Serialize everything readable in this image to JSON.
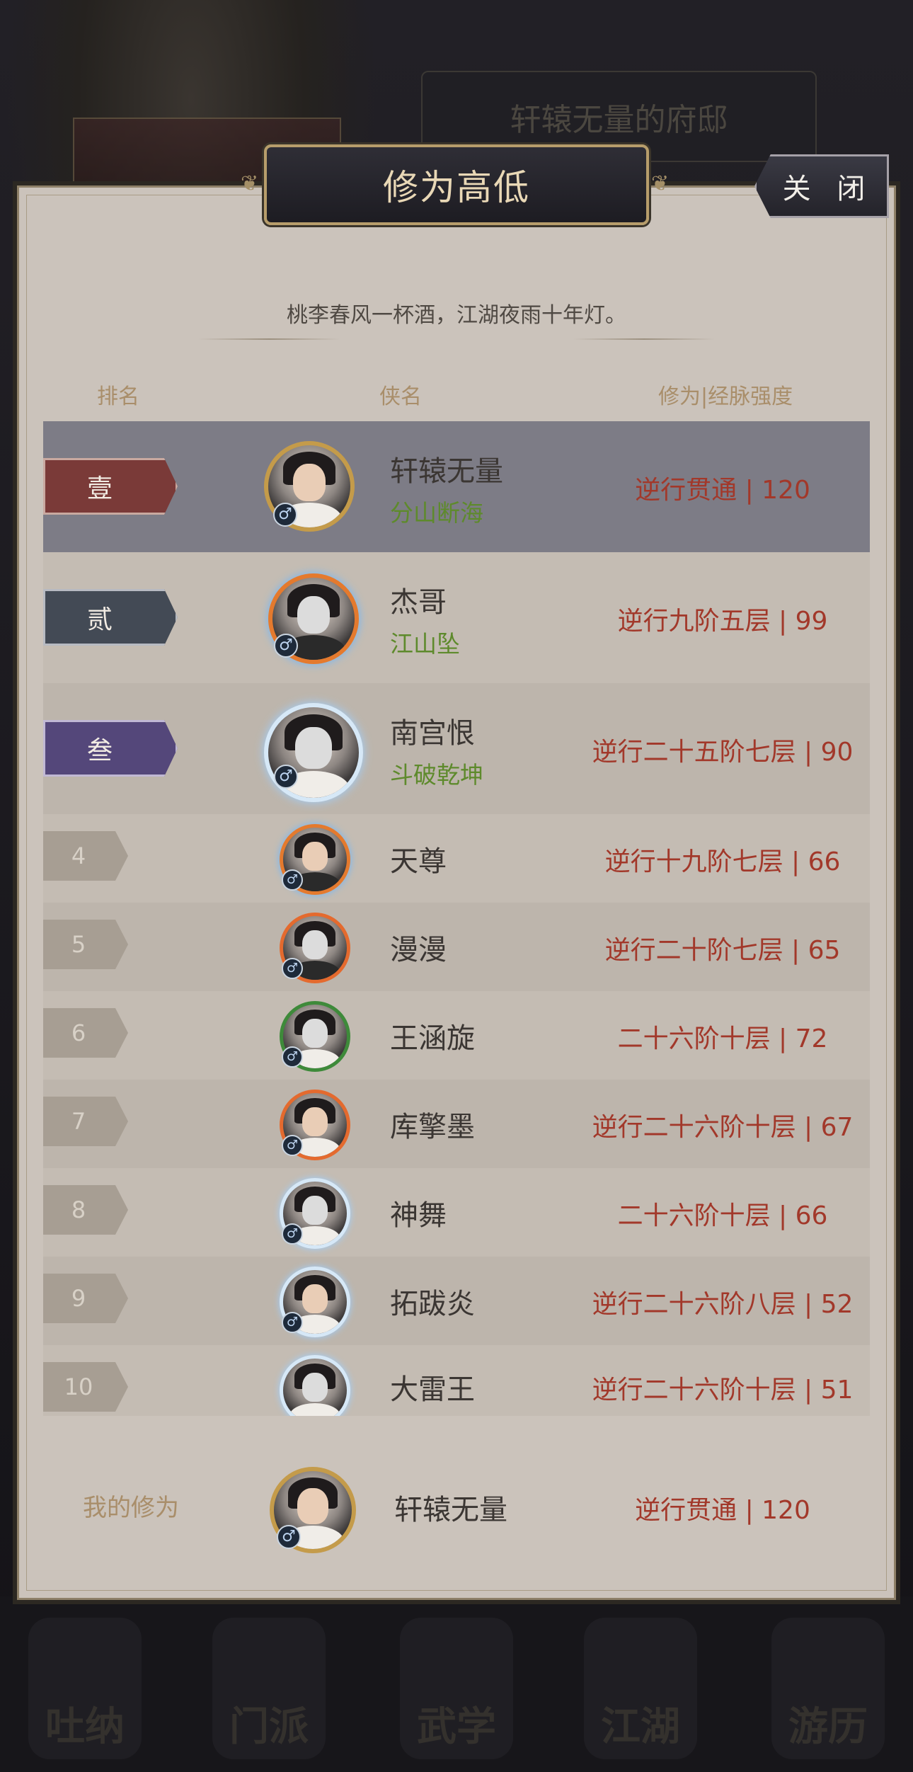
{
  "background": {
    "mansion_title": "轩辕无量的府邸",
    "nav": [
      "吐纳",
      "门派",
      "武学",
      "江湖",
      "游历"
    ]
  },
  "title": "修为高低",
  "close_label": "关 闭",
  "quote": "桃李春风一杯酒，江湖夜雨十年灯。",
  "headers": {
    "rank": "排名",
    "name": "侠名",
    "power": "修为|经脉强度"
  },
  "rows": [
    {
      "rank": "壹",
      "name": "轩辕无量",
      "sect": "分山断海",
      "power": "逆行贯通 | 120"
    },
    {
      "rank": "贰",
      "name": "杰哥",
      "sect": "江山坠",
      "power": "逆行九阶五层 | 99"
    },
    {
      "rank": "叁",
      "name": "南宫恨",
      "sect": "斗破乾坤",
      "power": "逆行二十五阶七层 | 90"
    },
    {
      "rank": "4",
      "name": "天尊",
      "power": "逆行十九阶七层 | 66"
    },
    {
      "rank": "5",
      "name": "漫漫",
      "power": "逆行二十阶七层 | 65"
    },
    {
      "rank": "6",
      "name": "王涵旋",
      "power": "二十六阶十层 | 72"
    },
    {
      "rank": "7",
      "name": "库擎墨",
      "power": "逆行二十六阶十层 | 67"
    },
    {
      "rank": "8",
      "name": "神舞",
      "power": "二十六阶十层 | 66"
    },
    {
      "rank": "9",
      "name": "拓跋炎",
      "power": "逆行二十六阶八层 | 52"
    },
    {
      "rank": "10",
      "name": "大雷王",
      "power": "逆行二十六阶十层 | 51"
    }
  ],
  "mine": {
    "label": "我的修为",
    "name": "轩辕无量",
    "power": "逆行贯通 | 120"
  },
  "colors": {
    "rank1": "#7a3a38",
    "rank2": "#434a55",
    "rank3": "#54477a",
    "highlight_row": "#7d7c86",
    "power_text": "#a2382a",
    "sect_text": "#5e8a2c"
  },
  "gender_symbol": "♂"
}
